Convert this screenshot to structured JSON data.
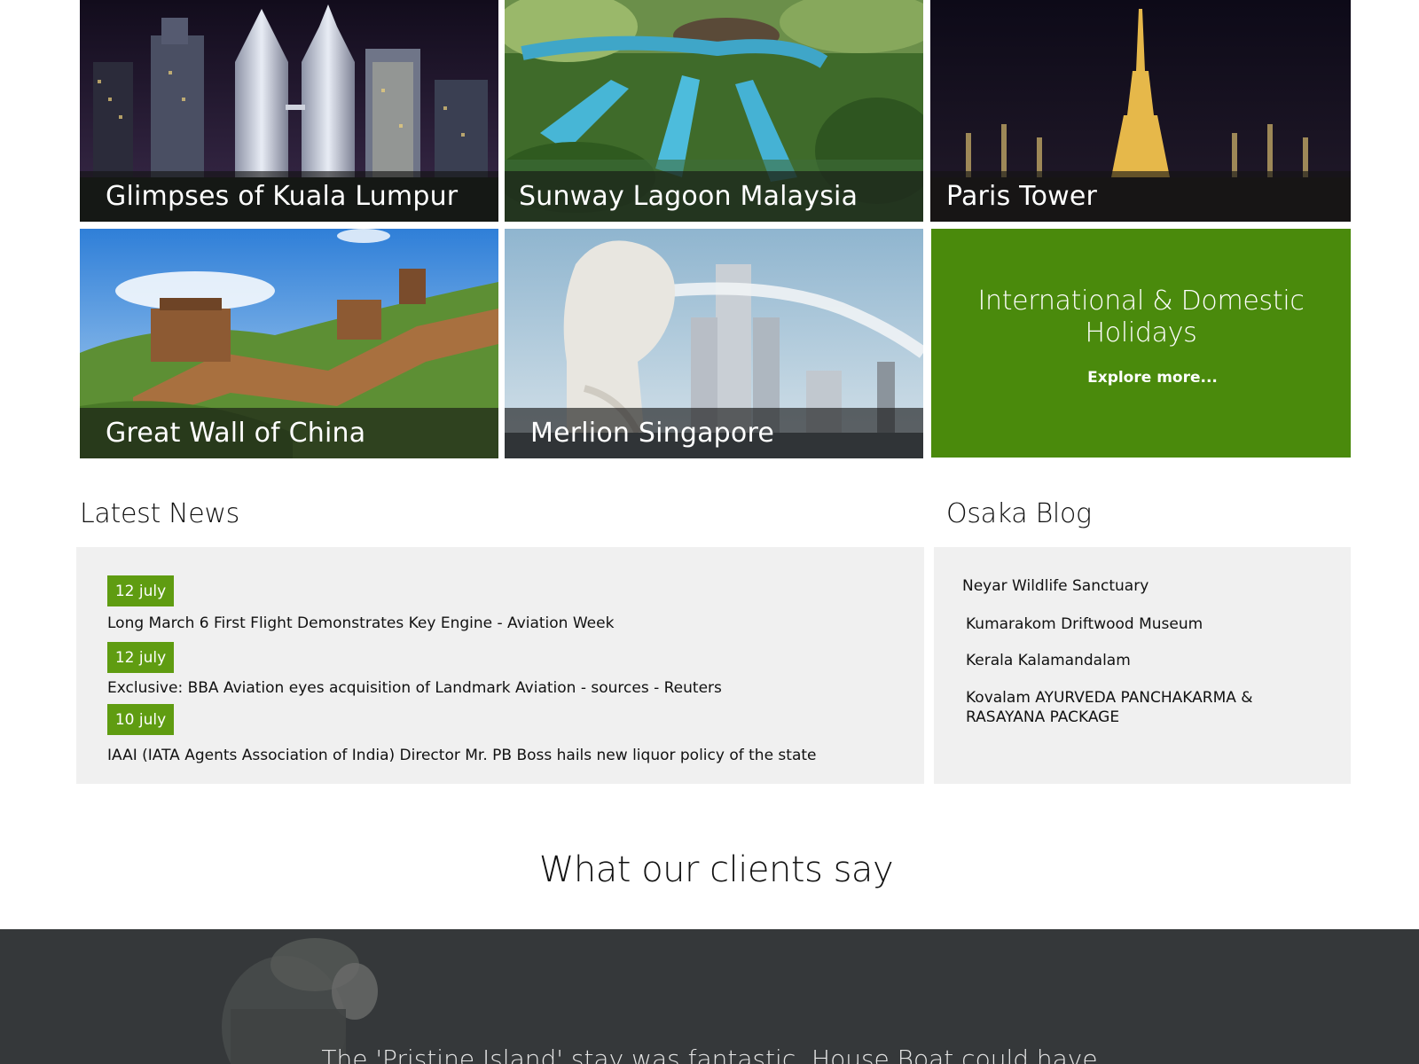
{
  "tiles": [
    {
      "id": "kl",
      "caption": "Glimpses of Kuala Lumpur"
    },
    {
      "id": "sunway",
      "caption": "Sunway Lagoon Malaysia"
    },
    {
      "id": "paris",
      "caption": "Paris Tower"
    },
    {
      "id": "wall",
      "caption": "Great Wall of China"
    },
    {
      "id": "merlion",
      "caption": "Merlion Singapore"
    }
  ],
  "promo": {
    "title": "International & Domestic Holidays",
    "link": "Explore more...",
    "color": "#4a8a0c"
  },
  "news": {
    "title": "Latest News",
    "items": [
      {
        "date": "12 july",
        "headline": "Long March 6 First Flight Demonstrates  Key Engine - Aviation Week"
      },
      {
        "date": "12 july",
        "headline": "Exclusive: BBA Aviation eyes acquisition of Landmark Aviation - sources - Reuters"
      },
      {
        "date": "10 july",
        "headline": "IAAI (IATA Agents Association of India) Director Mr. PB Boss hails new liquor policy of the state"
      }
    ],
    "badge_color": "#5f9c11"
  },
  "blog": {
    "title": "Osaka Blog",
    "items": [
      "Neyar Wildlife Sanctuary",
      "Kumarakom Driftwood Museum",
      "Kerala Kalamandalam",
      "Kovalam AYURVEDA PANCHAKARMA & RASAYANA PACKAGE"
    ]
  },
  "testimonials": {
    "title": "What our clients say",
    "quote": "The 'Pristine Island' stay was fantastic. House Boat could have"
  }
}
